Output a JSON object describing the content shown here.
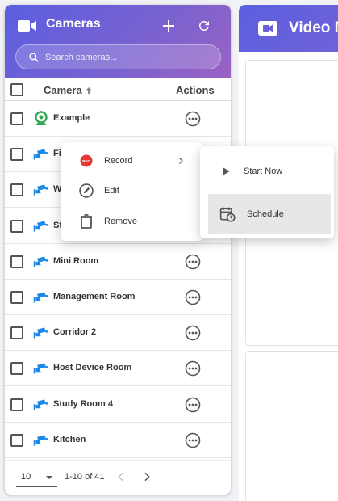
{
  "left_panel": {
    "title": "Cameras",
    "search_placeholder": "Search cameras...",
    "columns": {
      "camera": "Camera",
      "actions": "Actions"
    },
    "rows": [
      {
        "name": "Example",
        "icon": "webcam-icon",
        "color": "#34a853"
      },
      {
        "name": "Fi",
        "icon": "cctv-icon",
        "color": "#1e88e5"
      },
      {
        "name": "W",
        "icon": "cctv-icon",
        "color": "#1e88e5"
      },
      {
        "name": "St",
        "icon": "cctv-icon",
        "color": "#1e88e5"
      },
      {
        "name": "Mini Room",
        "icon": "cctv-icon",
        "color": "#1e88e5"
      },
      {
        "name": "Management Room",
        "icon": "cctv-icon",
        "color": "#1e88e5"
      },
      {
        "name": "Corridor 2",
        "icon": "cctv-icon",
        "color": "#1e88e5"
      },
      {
        "name": "Host Device Room",
        "icon": "cctv-icon",
        "color": "#1e88e5"
      },
      {
        "name": "Study Room 4",
        "icon": "cctv-icon",
        "color": "#1e88e5"
      },
      {
        "name": "Kitchen",
        "icon": "cctv-icon",
        "color": "#1e88e5"
      }
    ],
    "pagination": {
      "per_page": "10",
      "range": "1-10 of 41"
    }
  },
  "right_panel": {
    "title": "Video M"
  },
  "context_menu": {
    "items": [
      {
        "label": "Record",
        "icon": "rec-icon"
      },
      {
        "label": "Edit",
        "icon": "edit-icon"
      },
      {
        "label": "Remove",
        "icon": "trash-icon"
      }
    ]
  },
  "submenu": {
    "items": [
      {
        "label": "Start Now",
        "icon": "play-icon"
      },
      {
        "label": "Schedule",
        "icon": "calendar-clock-icon"
      }
    ]
  },
  "colors": {
    "header_gradient_start": "#5b5fe0",
    "header_gradient_end": "#9a62c4",
    "cctv": "#1e88e5",
    "webcam": "#34a853",
    "rec": "#e53935"
  }
}
